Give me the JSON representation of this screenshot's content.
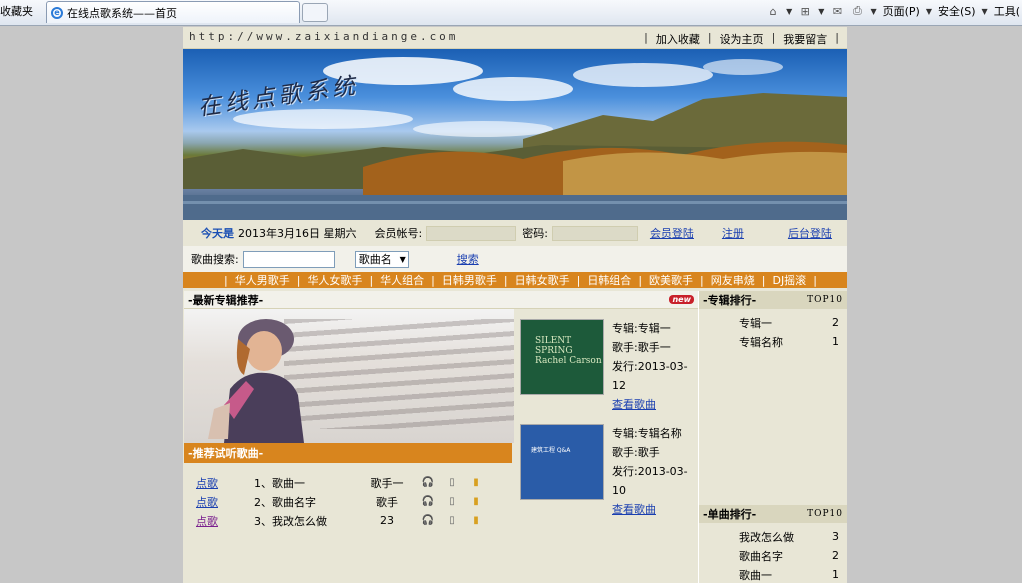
{
  "browser": {
    "favorites_label": "收藏夹",
    "tab_title": "在线点歌系统——首页",
    "menus": [
      "页面(P)",
      "安全(S)",
      "工具("
    ]
  },
  "site": {
    "url_text": "http://www.zaixiandiange.com",
    "top_links": [
      "加入收藏",
      "设为主页",
      "我要留言"
    ],
    "banner_title": "在线点歌系统"
  },
  "login": {
    "today_label": "今天是",
    "date_text": "2013年3月16日 星期六",
    "account_label": "会员帐号:",
    "password_label": "密码:",
    "login_link": "会员登陆",
    "register_link": "注册",
    "admin_link": "后台登陆"
  },
  "search": {
    "label": "歌曲搜索:",
    "select_value": "歌曲名",
    "button": "搜索"
  },
  "categories": [
    "华人男歌手",
    "华人女歌手",
    "华人组合",
    "日韩男歌手",
    "日韩女歌手",
    "日韩组合",
    "欧美歌手",
    "网友串烧",
    "DJ摇滚"
  ],
  "new_albums": {
    "title": "-最新专辑推荐-",
    "badge": "new",
    "items": [
      {
        "album": "专辑:专辑一",
        "singer": "歌手:歌手一",
        "release": "发行:2013-03-12",
        "link": "查看歌曲",
        "cover_text": "SILENT SPRING Rachel Carson"
      },
      {
        "album": "专辑:专辑名称",
        "singer": "歌手:歌手",
        "release": "发行:2013-03-10",
        "link": "查看歌曲",
        "cover_text": "建筑工程 Q&A"
      }
    ]
  },
  "recommended": {
    "title": "-推荐试听歌曲-",
    "songs": [
      {
        "action": "点歌",
        "name": "1、歌曲一",
        "singer": "歌手一"
      },
      {
        "action": "点歌",
        "name": "2、歌曲名字",
        "singer": "歌手"
      },
      {
        "action": "点歌",
        "name": "3、我改怎么做",
        "singer": "23"
      }
    ]
  },
  "album_rank": {
    "title": "-专辑排行-",
    "badge": "TOP10",
    "items": [
      {
        "name": "专辑一",
        "count": "2"
      },
      {
        "name": "专辑名称",
        "count": "1"
      }
    ]
  },
  "song_rank": {
    "title": "-单曲排行-",
    "badge": "TOP10",
    "items": [
      {
        "name": "我改怎么做",
        "count": "3"
      },
      {
        "name": "歌曲名字",
        "count": "2"
      },
      {
        "name": "歌曲一",
        "count": "1"
      }
    ]
  },
  "colors": {
    "accent_orange": "#d8851e",
    "link_blue": "#1a3fb0",
    "page_bg": "#e8e6d6"
  }
}
